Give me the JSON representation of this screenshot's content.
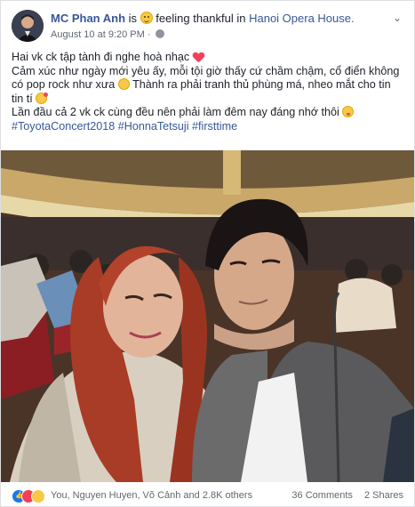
{
  "header": {
    "author": "MC Phan Anh",
    "is_word": "is",
    "feeling": "feeling thankful in",
    "place": "Hanoi Opera House.",
    "timestamp": "August 10 at 9:20 PM ·"
  },
  "body": {
    "line1": "Hai vk ck tập tành đi nghe hoà nhạc",
    "line2": "Cảm xúc như ngày mới yêu ấy, mỗi tội giờ thấy cứ chầm chậm, cổ điển không có pop rock như xưa",
    "line2b": "Thành ra phải tranh thủ phùng má, nheo mắt cho tin tin tí",
    "line3": "Lần đầu cả 2 vk ck cùng đều nên phải làm đêm nay đáng nhớ thôi",
    "hashtags": "#ToyotaConcert2018 #HonnaTetsuji #firsttime"
  },
  "footer": {
    "reactors": "You, Nguyen Huyen, Võ Cảnh and 2.8K others",
    "comments": "36 Comments",
    "shares": "2 Shares"
  },
  "icons": {
    "menu": "chevron-down-icon",
    "privacy": "globe-icon",
    "feeling": "smile-icon",
    "reactions": [
      "like-icon",
      "love-icon",
      "haha-icon"
    ]
  }
}
